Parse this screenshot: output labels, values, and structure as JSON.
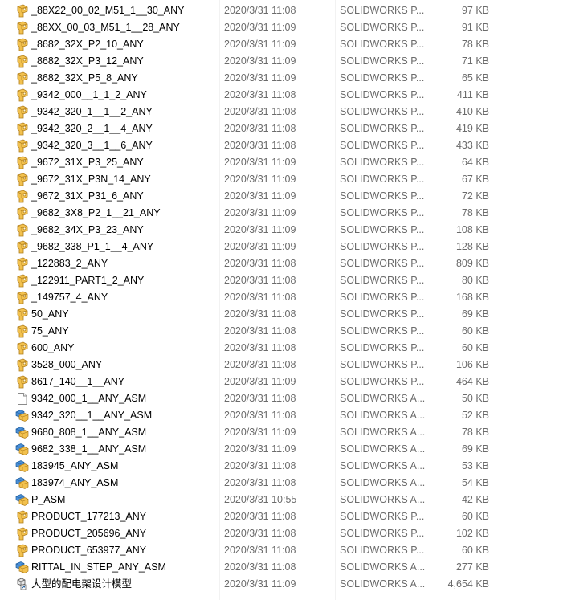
{
  "files": [
    {
      "name": "_88X22_00_02_M51_1__30_ANY",
      "date": "2020/3/31 11:08",
      "type": "SOLIDWORKS P...",
      "size": "97 KB",
      "icon": "solidworks-part-icon"
    },
    {
      "name": "_88XX_00_03_M51_1__28_ANY",
      "date": "2020/3/31 11:09",
      "type": "SOLIDWORKS P...",
      "size": "91 KB",
      "icon": "solidworks-part-icon"
    },
    {
      "name": "_8682_32X_P2_10_ANY",
      "date": "2020/3/31 11:09",
      "type": "SOLIDWORKS P...",
      "size": "78 KB",
      "icon": "solidworks-part-icon"
    },
    {
      "name": "_8682_32X_P3_12_ANY",
      "date": "2020/3/31 11:09",
      "type": "SOLIDWORKS P...",
      "size": "71 KB",
      "icon": "solidworks-part-icon"
    },
    {
      "name": "_8682_32X_P5_8_ANY",
      "date": "2020/3/31 11:09",
      "type": "SOLIDWORKS P...",
      "size": "65 KB",
      "icon": "solidworks-part-icon"
    },
    {
      "name": "_9342_000__1_1_2_ANY",
      "date": "2020/3/31 11:08",
      "type": "SOLIDWORKS P...",
      "size": "411 KB",
      "icon": "solidworks-part-icon"
    },
    {
      "name": "_9342_320_1__1__2_ANY",
      "date": "2020/3/31 11:08",
      "type": "SOLIDWORKS P...",
      "size": "410 KB",
      "icon": "solidworks-part-icon"
    },
    {
      "name": "_9342_320_2__1__4_ANY",
      "date": "2020/3/31 11:08",
      "type": "SOLIDWORKS P...",
      "size": "419 KB",
      "icon": "solidworks-part-icon"
    },
    {
      "name": "_9342_320_3__1__6_ANY",
      "date": "2020/3/31 11:08",
      "type": "SOLIDWORKS P...",
      "size": "433 KB",
      "icon": "solidworks-part-icon"
    },
    {
      "name": "_9672_31X_P3_25_ANY",
      "date": "2020/3/31 11:09",
      "type": "SOLIDWORKS P...",
      "size": "64 KB",
      "icon": "solidworks-part-icon"
    },
    {
      "name": "_9672_31X_P3N_14_ANY",
      "date": "2020/3/31 11:09",
      "type": "SOLIDWORKS P...",
      "size": "67 KB",
      "icon": "solidworks-part-icon"
    },
    {
      "name": "_9672_31X_P31_6_ANY",
      "date": "2020/3/31 11:09",
      "type": "SOLIDWORKS P...",
      "size": "72 KB",
      "icon": "solidworks-part-icon"
    },
    {
      "name": "_9682_3X8_P2_1__21_ANY",
      "date": "2020/3/31 11:09",
      "type": "SOLIDWORKS P...",
      "size": "78 KB",
      "icon": "solidworks-part-icon"
    },
    {
      "name": "_9682_34X_P3_23_ANY",
      "date": "2020/3/31 11:09",
      "type": "SOLIDWORKS P...",
      "size": "108 KB",
      "icon": "solidworks-part-icon"
    },
    {
      "name": "_9682_338_P1_1__4_ANY",
      "date": "2020/3/31 11:09",
      "type": "SOLIDWORKS P...",
      "size": "128 KB",
      "icon": "solidworks-part-icon"
    },
    {
      "name": "_122883_2_ANY",
      "date": "2020/3/31 11:08",
      "type": "SOLIDWORKS P...",
      "size": "809 KB",
      "icon": "solidworks-part-icon"
    },
    {
      "name": "_122911_PART1_2_ANY",
      "date": "2020/3/31 11:08",
      "type": "SOLIDWORKS P...",
      "size": "80 KB",
      "icon": "solidworks-part-icon"
    },
    {
      "name": "_149757_4_ANY",
      "date": "2020/3/31 11:08",
      "type": "SOLIDWORKS P...",
      "size": "168 KB",
      "icon": "solidworks-part-icon"
    },
    {
      "name": "50_ANY",
      "date": "2020/3/31 11:08",
      "type": "SOLIDWORKS P...",
      "size": "69 KB",
      "icon": "solidworks-part-icon"
    },
    {
      "name": "75_ANY",
      "date": "2020/3/31 11:08",
      "type": "SOLIDWORKS P...",
      "size": "60 KB",
      "icon": "solidworks-part-icon"
    },
    {
      "name": "600_ANY",
      "date": "2020/3/31 11:08",
      "type": "SOLIDWORKS P...",
      "size": "60 KB",
      "icon": "solidworks-part-icon"
    },
    {
      "name": "3528_000_ANY",
      "date": "2020/3/31 11:08",
      "type": "SOLIDWORKS P...",
      "size": "106 KB",
      "icon": "solidworks-part-icon"
    },
    {
      "name": "8617_140__1__ANY",
      "date": "2020/3/31 11:09",
      "type": "SOLIDWORKS P...",
      "size": "464 KB",
      "icon": "solidworks-part-icon"
    },
    {
      "name": "9342_000_1__ANY_ASM",
      "date": "2020/3/31 11:08",
      "type": "SOLIDWORKS A...",
      "size": "50 KB",
      "icon": "blank-file-icon"
    },
    {
      "name": "9342_320__1__ANY_ASM",
      "date": "2020/3/31 11:08",
      "type": "SOLIDWORKS A...",
      "size": "52 KB",
      "icon": "solidworks-assembly-icon"
    },
    {
      "name": "9680_808_1__ANY_ASM",
      "date": "2020/3/31 11:09",
      "type": "SOLIDWORKS A...",
      "size": "78 KB",
      "icon": "solidworks-assembly-icon"
    },
    {
      "name": "9682_338_1__ANY_ASM",
      "date": "2020/3/31 11:09",
      "type": "SOLIDWORKS A...",
      "size": "69 KB",
      "icon": "solidworks-assembly-icon"
    },
    {
      "name": "183945_ANY_ASM",
      "date": "2020/3/31 11:08",
      "type": "SOLIDWORKS A...",
      "size": "53 KB",
      "icon": "solidworks-assembly-icon"
    },
    {
      "name": "183974_ANY_ASM",
      "date": "2020/3/31 11:08",
      "type": "SOLIDWORKS A...",
      "size": "54 KB",
      "icon": "solidworks-assembly-icon"
    },
    {
      "name": "P_ASM",
      "date": "2020/3/31 10:55",
      "type": "SOLIDWORKS A...",
      "size": "42 KB",
      "icon": "solidworks-assembly-icon"
    },
    {
      "name": "PRODUCT_177213_ANY",
      "date": "2020/3/31 11:08",
      "type": "SOLIDWORKS P...",
      "size": "60 KB",
      "icon": "solidworks-part-icon"
    },
    {
      "name": "PRODUCT_205696_ANY",
      "date": "2020/3/31 11:08",
      "type": "SOLIDWORKS P...",
      "size": "102 KB",
      "icon": "solidworks-part-icon"
    },
    {
      "name": "PRODUCT_653977_ANY",
      "date": "2020/3/31 11:08",
      "type": "SOLIDWORKS P...",
      "size": "60 KB",
      "icon": "solidworks-part-icon"
    },
    {
      "name": "RITTAL_IN_STEP_ANY_ASM",
      "date": "2020/3/31 11:08",
      "type": "SOLIDWORKS A...",
      "size": "277 KB",
      "icon": "solidworks-assembly-icon"
    },
    {
      "name": "大型的配电架设计模型",
      "date": "2020/3/31 11:09",
      "type": "SOLIDWORKS A...",
      "size": "4,654 KB",
      "icon": "solidworks-assembly-shortcut-icon"
    }
  ]
}
